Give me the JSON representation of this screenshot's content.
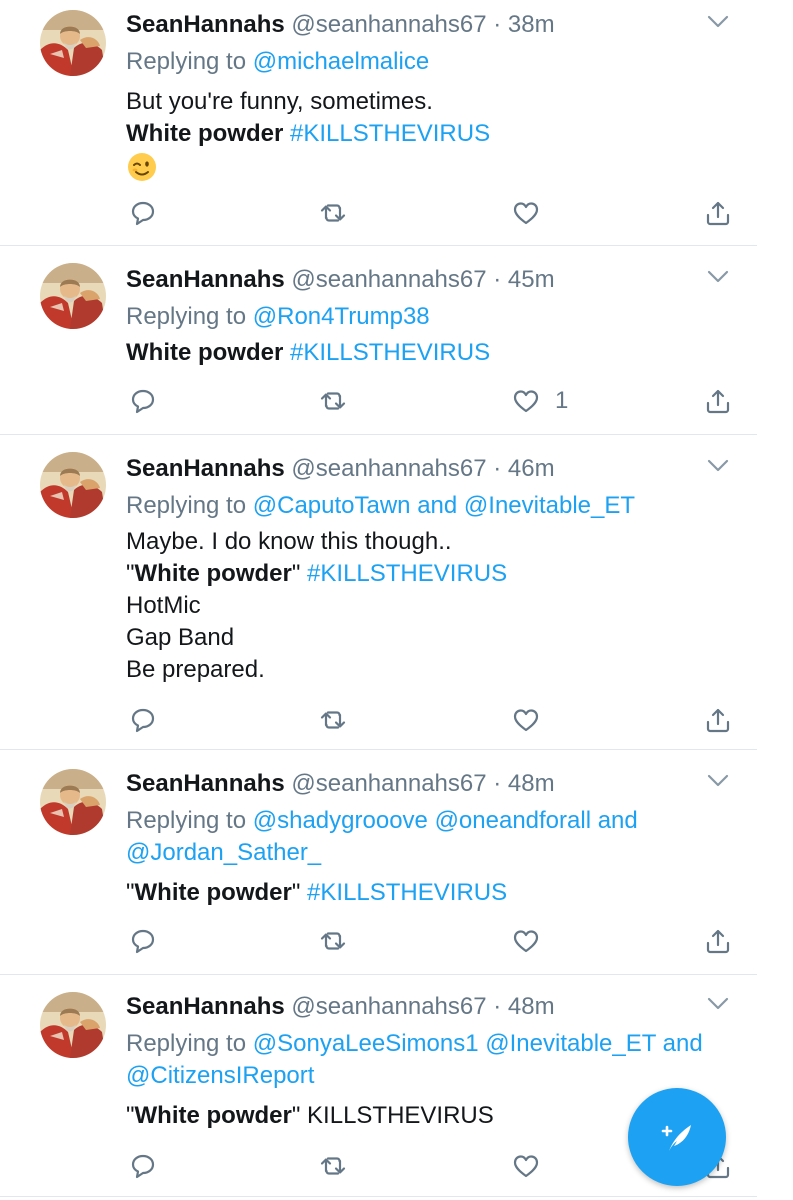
{
  "icons": {
    "reply": "reply-icon",
    "retweet": "retweet-icon",
    "like": "heart-icon",
    "share": "share-icon",
    "menu": "chevron-down-icon",
    "compose": "compose-tweet-icon"
  },
  "colors": {
    "accent": "#1da1f2",
    "muted": "#657786",
    "text": "#14171a",
    "divider": "#e1e8ed"
  },
  "replying_prefix": "Replying to ",
  "tweets": [
    {
      "name": "SeanHannahs",
      "handle": "@seanhannahs67",
      "time": "38m",
      "reply_to": [
        "@michaelmalice"
      ],
      "lines": [
        "But you're funny, sometimes."
      ],
      "bold": "White powder",
      "hashtag": "#KILLSTHEVIRUS",
      "emoji": "winking-face",
      "like_count": ""
    },
    {
      "name": "SeanHannahs",
      "handle": "@seanhannahs67",
      "time": "45m",
      "reply_to": [
        "@Ron4Trump38"
      ],
      "bold": "White powder",
      "hashtag": "#KILLSTHEVIRUS",
      "like_count": "1"
    },
    {
      "name": "SeanHannahs",
      "handle": "@seanhannahs67",
      "time": "46m",
      "reply_to": [
        "@CaputoTawn",
        "@Inevitable_ET"
      ],
      "lines": [
        "Maybe. I do know this though.."
      ],
      "bold": "White powder",
      "hashtag": "#KILLSTHEVIRUS",
      "after_lines": [
        "HotMic",
        "Gap Band",
        "Be prepared."
      ],
      "like_count": ""
    },
    {
      "name": "SeanHannahs",
      "handle": "@seanhannahs67",
      "time": "48m",
      "reply_to": [
        "@shadygrooove",
        "@oneandforall",
        "@Jordan_Sather_"
      ],
      "bold": "White powder",
      "hashtag": "#KILLSTHEVIRUS",
      "like_count": ""
    },
    {
      "name": "SeanHannahs",
      "handle": "@seanhannahs67",
      "time": "48m",
      "reply_to": [
        "@SonyaLeeSimons1",
        "@Inevitable_ET",
        "@CitizensIReport"
      ],
      "bold": "White powder",
      "plain_tail": "KILLSTHEVIRUS",
      "like_count": ""
    }
  ]
}
